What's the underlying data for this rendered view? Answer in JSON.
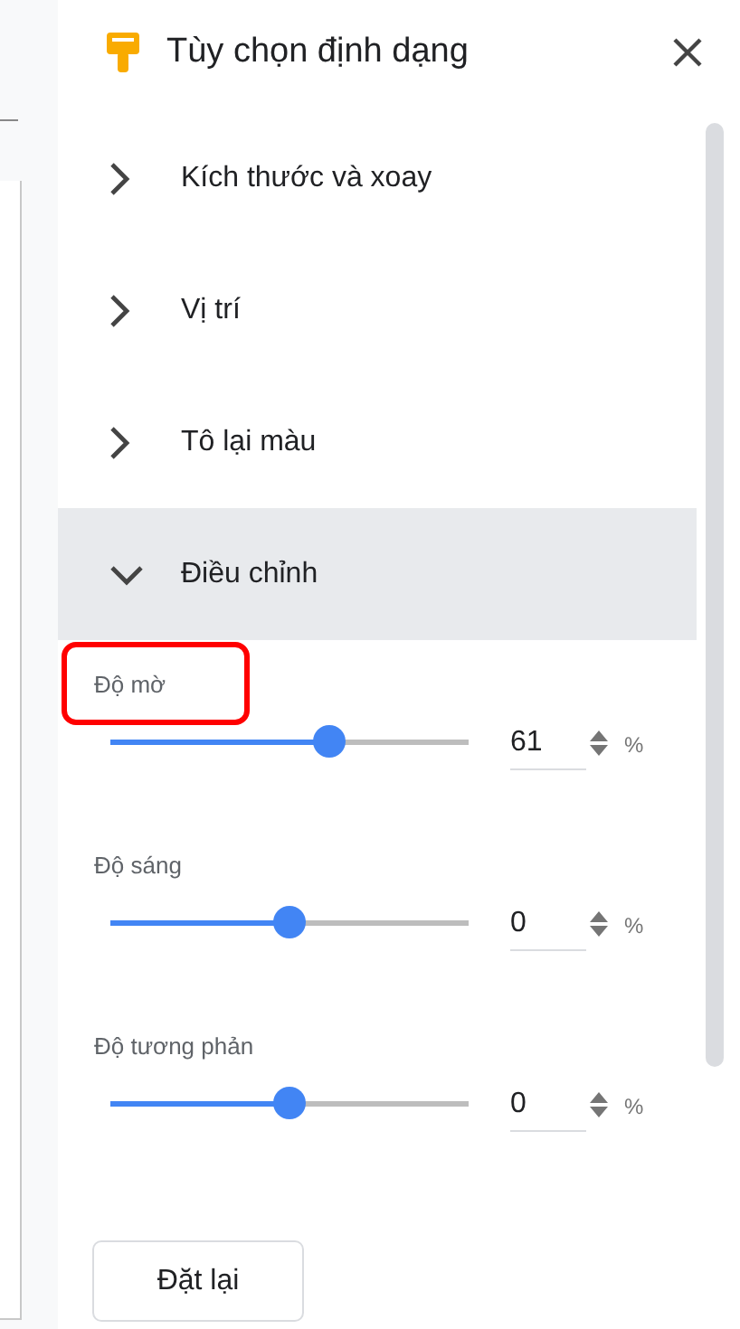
{
  "panel": {
    "title": "Tùy chọn định dạng"
  },
  "sections": [
    {
      "label": "Kích thước và xoay",
      "expanded": false
    },
    {
      "label": "Vị trí",
      "expanded": false
    },
    {
      "label": "Tô lại màu",
      "expanded": false
    },
    {
      "label": "Điều chỉnh",
      "expanded": true
    }
  ],
  "adjustments": [
    {
      "label": "Độ mờ",
      "level": 0.61,
      "value": "61",
      "unit": "%",
      "highlighted": true
    },
    {
      "label": "Độ sáng",
      "level": 0.5,
      "value": "0",
      "unit": "%",
      "highlighted": false
    },
    {
      "label": "Độ tương phản",
      "level": 0.5,
      "value": "0",
      "unit": "%",
      "highlighted": false
    }
  ],
  "reset_button": "Đặt lại"
}
